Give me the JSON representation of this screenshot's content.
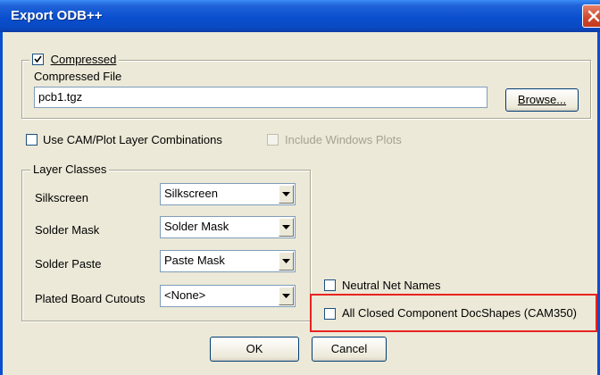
{
  "window": {
    "title": "Export ODB++"
  },
  "compressed_group": {
    "compressed_label": "Compressed",
    "compressed_checked": true,
    "file_label": "Compressed File",
    "file_value": "pcb1.tgz",
    "browse_label": "Browse..."
  },
  "options": {
    "use_cam_label": "Use CAM/Plot Layer Combinations",
    "use_cam_checked": false,
    "include_windows_label": "Include Windows Plots",
    "include_windows_checked": false,
    "neutral_net_label": "Neutral Net Names",
    "neutral_net_checked": false,
    "closed_shapes_label": "All Closed Component DocShapes (CAM350)",
    "closed_shapes_checked": false
  },
  "layer_classes": {
    "title": "Layer Classes",
    "rows": [
      {
        "label": "Silkscreen",
        "value": "Silkscreen"
      },
      {
        "label": "Solder Mask",
        "value": "Solder Mask"
      },
      {
        "label": "Solder Paste",
        "value": "Paste Mask"
      },
      {
        "label": "Plated Board Cutouts",
        "value": "<None>"
      }
    ]
  },
  "buttons": {
    "ok": "OK",
    "cancel": "Cancel"
  },
  "colors": {
    "titlebar": "#0a4fcf",
    "highlight": "#e8231f",
    "dialog_bg": "#ece9d8"
  }
}
